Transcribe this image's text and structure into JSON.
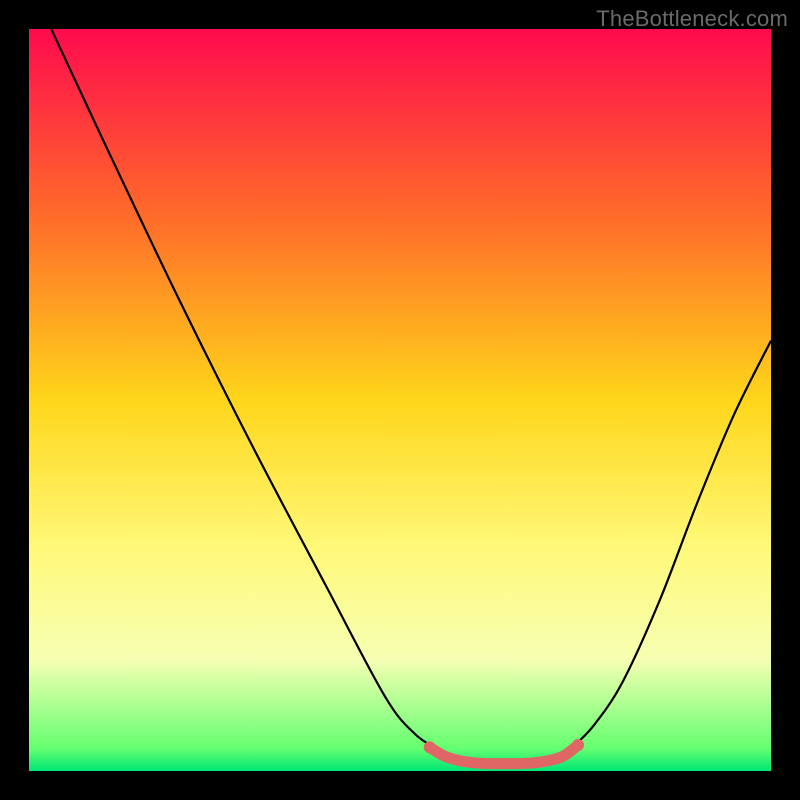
{
  "watermark": "TheBottleneck.com",
  "chart_data": {
    "type": "line",
    "title": "",
    "xlabel": "",
    "ylabel": "",
    "xlim": [
      0,
      100
    ],
    "ylim": [
      0,
      100
    ],
    "gradient_stops": [
      {
        "offset": 0,
        "color": "#ff0b4e"
      },
      {
        "offset": 0.25,
        "color": "#ff6a2a"
      },
      {
        "offset": 0.5,
        "color": "#ffd61a"
      },
      {
        "offset": 0.7,
        "color": "#fff97a"
      },
      {
        "offset": 0.85,
        "color": "#f6ffb3"
      },
      {
        "offset": 0.97,
        "color": "#64ff70"
      },
      {
        "offset": 1.0,
        "color": "#00e676"
      }
    ],
    "series": [
      {
        "name": "left-curve",
        "color": "#000000",
        "x": [
          3,
          10,
          20,
          30,
          40,
          48,
          52,
          55
        ],
        "y": [
          100,
          85,
          64,
          44,
          25,
          10,
          5,
          3
        ]
      },
      {
        "name": "right-curve",
        "color": "#000000",
        "x": [
          73,
          76,
          80,
          85,
          90,
          95,
          100
        ],
        "y": [
          3,
          6,
          12,
          23,
          36,
          48,
          58
        ]
      },
      {
        "name": "bottom-marker",
        "color": "#e06666",
        "style": "marker",
        "x": [
          54,
          56,
          58,
          60,
          62,
          64,
          66,
          68,
          70,
          72,
          74
        ],
        "y": [
          3.2,
          2.0,
          1.4,
          1.1,
          1.0,
          1.0,
          1.0,
          1.1,
          1.4,
          2.0,
          3.5
        ]
      }
    ]
  }
}
